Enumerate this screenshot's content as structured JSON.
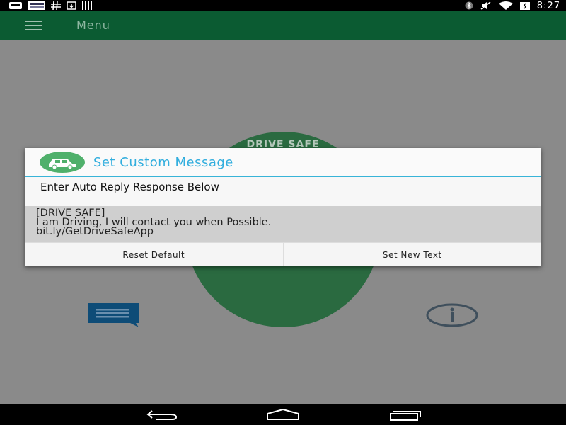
{
  "status_bar": {
    "time": "8:27",
    "left_icons": [
      "message-icon",
      "news-icon",
      "hashtag-icon",
      "download-icon",
      "barcode-icon"
    ],
    "right_icons": [
      "bluetooth-icon",
      "mute-icon",
      "wifi-icon",
      "battery-icon"
    ]
  },
  "app_bar": {
    "menu_label": "Menu",
    "color": "#0b5b32"
  },
  "main": {
    "circle_label": "DRIVE SAFE"
  },
  "dialog": {
    "title": "Set Custom Message",
    "prompt": "Enter Auto Reply Response Below",
    "message_lines": [
      "[DRIVE SAFE]",
      "I am Driving, I will contact you when Possible.",
      "bit.ly/GetDriveSafeApp"
    ],
    "buttons": {
      "reset": "Reset Default",
      "set_new": "Set New Text"
    },
    "accent_color": "#32aede"
  },
  "nav_bar": {
    "icons": [
      "back-icon",
      "home-icon",
      "recent-apps-icon"
    ]
  }
}
